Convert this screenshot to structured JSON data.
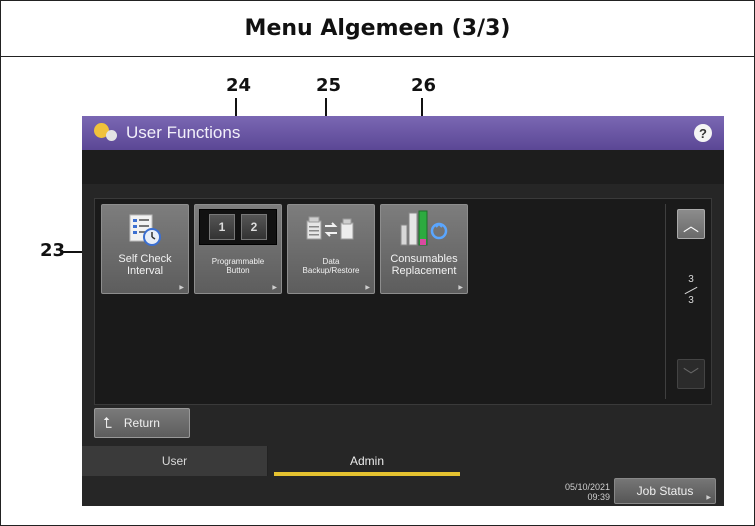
{
  "document": {
    "title": "Menu Algemeen (3/3)"
  },
  "callouts": [
    "23",
    "24",
    "25",
    "26"
  ],
  "window": {
    "title": "User Functions",
    "help_icon": "?"
  },
  "functions": [
    {
      "label_line1": "Self Check",
      "label_line2": "Interval",
      "icon": "checklist-clock-icon"
    },
    {
      "label_line1": "Programmable",
      "label_line2": "Button",
      "icon": "programmable-keys-icon",
      "keys": [
        "1",
        "2"
      ]
    },
    {
      "label_line1": "Data",
      "label_line2": "Backup/Restore",
      "icon": "data-transfer-icon"
    },
    {
      "label_line1": "Consumables",
      "label_line2": "Replacement",
      "icon": "toner-refresh-icon"
    }
  ],
  "pager": {
    "current": "3",
    "total": "3"
  },
  "return_label": "Return",
  "tabs": [
    {
      "label": "User",
      "active": false
    },
    {
      "label": "Admin",
      "active": true
    }
  ],
  "status": {
    "date": "05/10/2021",
    "time": "09:39",
    "job_status_label": "Job Status"
  },
  "colors": {
    "titlebar": "#6a56a4",
    "active_tab_underline": "#e5c230",
    "background": "#262626"
  }
}
